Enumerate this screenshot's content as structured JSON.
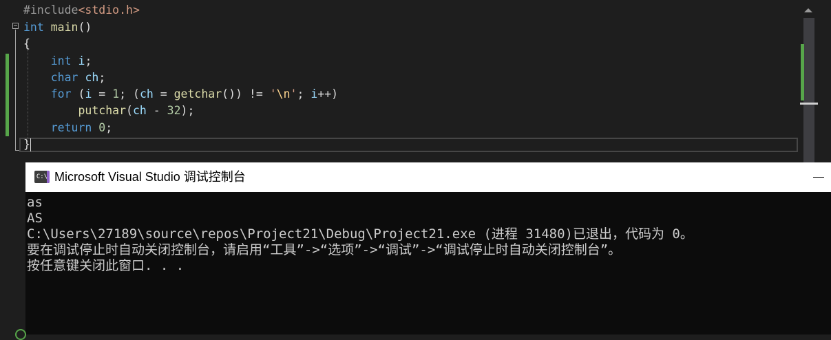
{
  "editor": {
    "lines": [
      {
        "segments": [
          {
            "t": "#include",
            "c": "pp"
          },
          {
            "t": "<stdio.h>",
            "c": "str"
          }
        ]
      },
      {
        "segments": [
          {
            "t": "int",
            "c": "kw"
          },
          {
            "t": " ",
            "c": ""
          },
          {
            "t": "main",
            "c": "fn"
          },
          {
            "t": "()",
            "c": ""
          }
        ]
      },
      {
        "segments": [
          {
            "t": "{",
            "c": ""
          }
        ]
      },
      {
        "segments": [
          {
            "t": "    ",
            "c": ""
          },
          {
            "t": "int",
            "c": "kw"
          },
          {
            "t": " ",
            "c": ""
          },
          {
            "t": "i",
            "c": "id"
          },
          {
            "t": ";",
            "c": ""
          }
        ]
      },
      {
        "segments": [
          {
            "t": "    ",
            "c": ""
          },
          {
            "t": "char",
            "c": "kw"
          },
          {
            "t": " ",
            "c": ""
          },
          {
            "t": "ch",
            "c": "id"
          },
          {
            "t": ";",
            "c": ""
          }
        ]
      },
      {
        "segments": [
          {
            "t": "    ",
            "c": ""
          },
          {
            "t": "for",
            "c": "kw"
          },
          {
            "t": " (",
            "c": ""
          },
          {
            "t": "i",
            "c": "id"
          },
          {
            "t": " = ",
            "c": ""
          },
          {
            "t": "1",
            "c": "num"
          },
          {
            "t": "; (",
            "c": ""
          },
          {
            "t": "ch",
            "c": "id"
          },
          {
            "t": " = ",
            "c": ""
          },
          {
            "t": "getchar",
            "c": "fn"
          },
          {
            "t": "()) != ",
            "c": ""
          },
          {
            "t": "'",
            "c": "str"
          },
          {
            "t": "\\n",
            "c": "esc"
          },
          {
            "t": "'",
            "c": "str"
          },
          {
            "t": "; ",
            "c": ""
          },
          {
            "t": "i",
            "c": "id"
          },
          {
            "t": "++)",
            "c": ""
          }
        ]
      },
      {
        "segments": [
          {
            "t": "        ",
            "c": ""
          },
          {
            "t": "putchar",
            "c": "fn"
          },
          {
            "t": "(",
            "c": ""
          },
          {
            "t": "ch",
            "c": "id"
          },
          {
            "t": " - ",
            "c": ""
          },
          {
            "t": "32",
            "c": "num"
          },
          {
            "t": ");",
            "c": ""
          }
        ]
      },
      {
        "segments": [
          {
            "t": "    ",
            "c": ""
          },
          {
            "t": "return",
            "c": "kw"
          },
          {
            "t": " ",
            "c": ""
          },
          {
            "t": "0",
            "c": "num"
          },
          {
            "t": ";",
            "c": ""
          }
        ]
      },
      {
        "segments": [
          {
            "t": "}",
            "c": ""
          }
        ]
      }
    ]
  },
  "console": {
    "icon_text": "C:\\",
    "title": "Microsoft Visual Studio 调试控制台",
    "output_lines": [
      "as",
      "AS",
      "C:\\Users\\27189\\source\\repos\\Project21\\Debug\\Project21.exe (进程 31480)已退出，代码为 0。",
      "要在调试停止时自动关闭控制台，请启用“工具”->“选项”->“调试”->“调试停止时自动关闭控制台”。",
      "按任意键关闭此窗口. . ."
    ]
  }
}
